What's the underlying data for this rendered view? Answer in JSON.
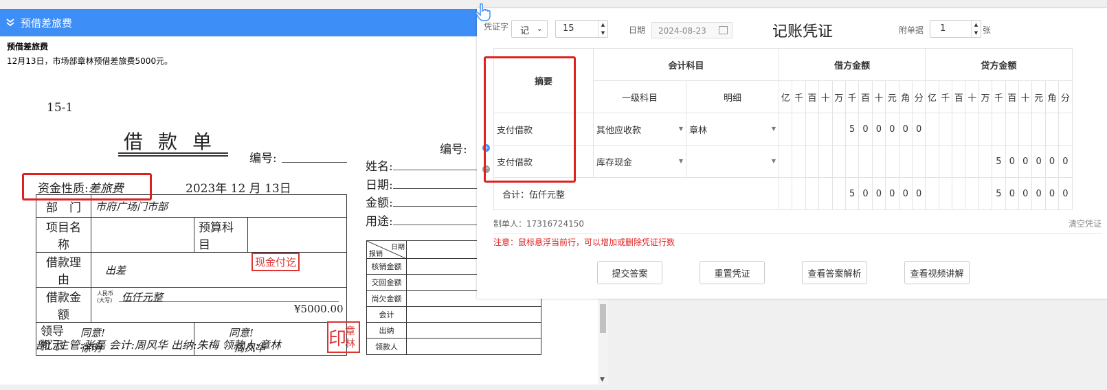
{
  "header": {
    "title": "预借差旅费"
  },
  "question": {
    "title": "预借差旅费",
    "text": "12月13日，市场部章林预借差旅费5000元。"
  },
  "document": {
    "code": "15-1",
    "title": "借款单",
    "bianhao_label": "编号:",
    "bianhao_label2": "编号:",
    "fund_nature_label": "资金性质:",
    "fund_nature_value": "差旅费",
    "date": "2023年 12 月 13日",
    "rows": {
      "dept_label": "部　门",
      "dept_value": "市府广场门市部",
      "project_label": "项目名称",
      "budget_label": "预算科目",
      "reason_label": "借款理由",
      "reason_value": "出差",
      "amount_label": "借款金额",
      "rmb_label": "人民币",
      "rmb_sub": "(大写)",
      "amount_words": "伍仟元整",
      "amount_num": "¥5000.00",
      "leader_label_1": "领导",
      "leader_label_2": "批示",
      "approve_1": "同意!",
      "approver_1": "徐明",
      "approve_2": "同意!",
      "approver_2": "周凤华"
    },
    "stamp_cash": "现金付讫",
    "stamp_seal_a": "印",
    "stamp_seal_b1": "章",
    "stamp_seal_b2": "林",
    "signatures": "部门主管:张磊  会计:周风华 出纳:朱梅 领款人:章林",
    "right_fields": [
      "姓名:",
      "日期:",
      "金额:",
      "用途:"
    ],
    "reimb": {
      "diag_top": "日期",
      "diag_bottom": "报销",
      "rows": [
        "核销金额",
        "交回金额",
        "尚欠金额",
        "会计",
        "出纳",
        "领款人"
      ]
    }
  },
  "voucher": {
    "word_label": "凭证字",
    "word_value": "记",
    "number_value": "15",
    "date_label": "日期",
    "date_value": "2024-08-23",
    "title": "记账凭证",
    "attach_label": "附单据",
    "attach_value": "1",
    "attach_unit": "张",
    "col_summary": "摘要",
    "col_account": "会计科目",
    "col_level1": "一级科目",
    "col_detail": "明细",
    "col_debit": "借方金额",
    "col_credit": "贷方金额",
    "digits": [
      "亿",
      "千",
      "百",
      "十",
      "万",
      "千",
      "百",
      "十",
      "元",
      "角",
      "分"
    ],
    "rows": [
      {
        "summary": "支付借款",
        "account": "其他应收款",
        "detail": "章林",
        "debit": [
          "",
          "",
          "",
          "",
          "",
          "5",
          "0",
          "0",
          "0",
          "0",
          "0"
        ],
        "credit": [
          "",
          "",
          "",
          "",
          "",
          "",
          "",
          "",
          "",
          "",
          ""
        ]
      },
      {
        "summary": "支付借款",
        "account": "库存现金",
        "detail": "",
        "debit": [
          "",
          "",
          "",
          "",
          "",
          "",
          "",
          "",
          "",
          "",
          ""
        ],
        "credit": [
          "",
          "",
          "",
          "",
          "",
          "5",
          "0",
          "0",
          "0",
          "0",
          "0"
        ]
      }
    ],
    "total_label": "合计：伍仟元整",
    "total_debit": [
      "",
      "",
      "",
      "",
      "",
      "5",
      "0",
      "0",
      "0",
      "0",
      "0"
    ],
    "total_credit": [
      "",
      "",
      "",
      "",
      "",
      "5",
      "0",
      "0",
      "0",
      "0",
      "0"
    ],
    "maker": "制单人：17316724150",
    "clear": "清空凭证",
    "note": "注意：鼠标悬浮当前行，可以增加或删除凭证行数",
    "buttons": [
      "提交答案",
      "重置凭证",
      "查看答案解析",
      "查看视频讲解"
    ]
  },
  "colors": {
    "accent": "#3e8ef7",
    "highlight": "#e02020",
    "stamp": "#d33333"
  }
}
